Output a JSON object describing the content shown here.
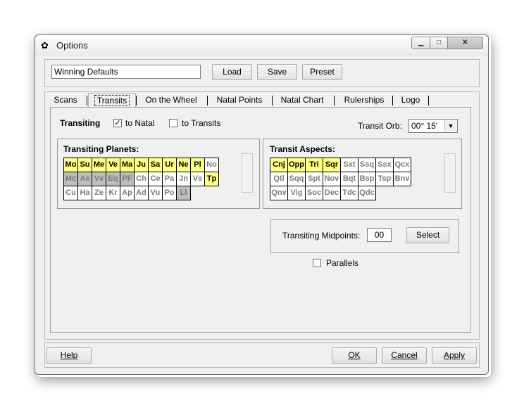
{
  "window": {
    "title": "Options",
    "icon": "app-icon"
  },
  "preset": {
    "name_value": "Winning Defaults",
    "load_label": "Load",
    "save_label": "Save",
    "preset_label": "Preset"
  },
  "tabs": [
    {
      "label": "Scans"
    },
    {
      "label": "Transits"
    },
    {
      "label": "On the Wheel"
    },
    {
      "label": "Natal Points"
    },
    {
      "label": "Natal Chart"
    },
    {
      "label": "Rulerships"
    },
    {
      "label": "Logo"
    }
  ],
  "transits": {
    "transiting_label": "Transiting",
    "to_natal_label": "to Natal",
    "to_natal_checked": true,
    "to_transits_label": "to Transits",
    "to_transits_checked": false,
    "orb_label": "Transit Orb:",
    "orb_value": "00° 15'"
  },
  "planets": {
    "title": "Transiting Planets:",
    "rows": [
      [
        {
          "t": "Mo",
          "s": "on"
        },
        {
          "t": "Su",
          "s": "on"
        },
        {
          "t": "Me",
          "s": "on"
        },
        {
          "t": "Ve",
          "s": "on"
        },
        {
          "t": "Ma",
          "s": "on"
        },
        {
          "t": "Ju",
          "s": "on"
        },
        {
          "t": "Sa",
          "s": "on"
        },
        {
          "t": "Ur",
          "s": "on"
        },
        {
          "t": "Ne",
          "s": "on"
        },
        {
          "t": "Pl",
          "s": "on"
        },
        {
          "t": "No",
          "s": "off"
        }
      ],
      [
        {
          "t": "Mc",
          "s": "grey"
        },
        {
          "t": "As",
          "s": "grey"
        },
        {
          "t": "Vx",
          "s": "grey"
        },
        {
          "t": "Eq",
          "s": "grey"
        },
        {
          "t": "PF",
          "s": "grey"
        },
        {
          "t": "Ch",
          "s": "off"
        },
        {
          "t": "Ce",
          "s": "off"
        },
        {
          "t": "Pa",
          "s": "off"
        },
        {
          "t": "Jn",
          "s": "off"
        },
        {
          "t": "Vs",
          "s": "off"
        },
        {
          "t": "Tp",
          "s": "on"
        }
      ],
      [
        {
          "t": "Cu",
          "s": "off"
        },
        {
          "t": "Ha",
          "s": "off"
        },
        {
          "t": "Ze",
          "s": "off"
        },
        {
          "t": "Kr",
          "s": "off"
        },
        {
          "t": "Ap",
          "s": "off"
        },
        {
          "t": "Ad",
          "s": "off"
        },
        {
          "t": "Vu",
          "s": "off"
        },
        {
          "t": "Po",
          "s": "off"
        },
        {
          "t": "Ll",
          "s": "grey"
        }
      ]
    ]
  },
  "aspects": {
    "title": "Transit Aspects:",
    "rows": [
      [
        {
          "t": "Cnj",
          "s": "on"
        },
        {
          "t": "Opp",
          "s": "on"
        },
        {
          "t": "Tri",
          "s": "on"
        },
        {
          "t": "Sqr",
          "s": "on"
        },
        {
          "t": "Sxt",
          "s": "off"
        },
        {
          "t": "Ssq",
          "s": "off"
        },
        {
          "t": "Ssx",
          "s": "off"
        },
        {
          "t": "Qcx",
          "s": "off"
        }
      ],
      [
        {
          "t": "Qtl",
          "s": "off"
        },
        {
          "t": "Sqq",
          "s": "off"
        },
        {
          "t": "Spt",
          "s": "off"
        },
        {
          "t": "Nov",
          "s": "off"
        },
        {
          "t": "Bqt",
          "s": "off"
        },
        {
          "t": "Bsp",
          "s": "off"
        },
        {
          "t": "Tsp",
          "s": "off"
        },
        {
          "t": "Bnv",
          "s": "off"
        }
      ],
      [
        {
          "t": "Qnv",
          "s": "off"
        },
        {
          "t": "Vig",
          "s": "off"
        },
        {
          "t": "Soc",
          "s": "off"
        },
        {
          "t": "Dec",
          "s": "off"
        },
        {
          "t": "Tdc",
          "s": "off"
        },
        {
          "t": "Qdc",
          "s": "off"
        }
      ]
    ]
  },
  "midpoints": {
    "label": "Transiting Midpoints:",
    "value": "00",
    "select_label": "Select"
  },
  "parallels": {
    "label": "Parallels",
    "checked": false
  },
  "footer": {
    "help_label": "Help",
    "ok_label": "OK",
    "cancel_label": "Cancel",
    "apply_label": "Apply"
  },
  "colors": {
    "selected_cell": "#ffff80",
    "disabled_cell": "#bdbdbd",
    "window_bg": "#f0f0f0"
  }
}
